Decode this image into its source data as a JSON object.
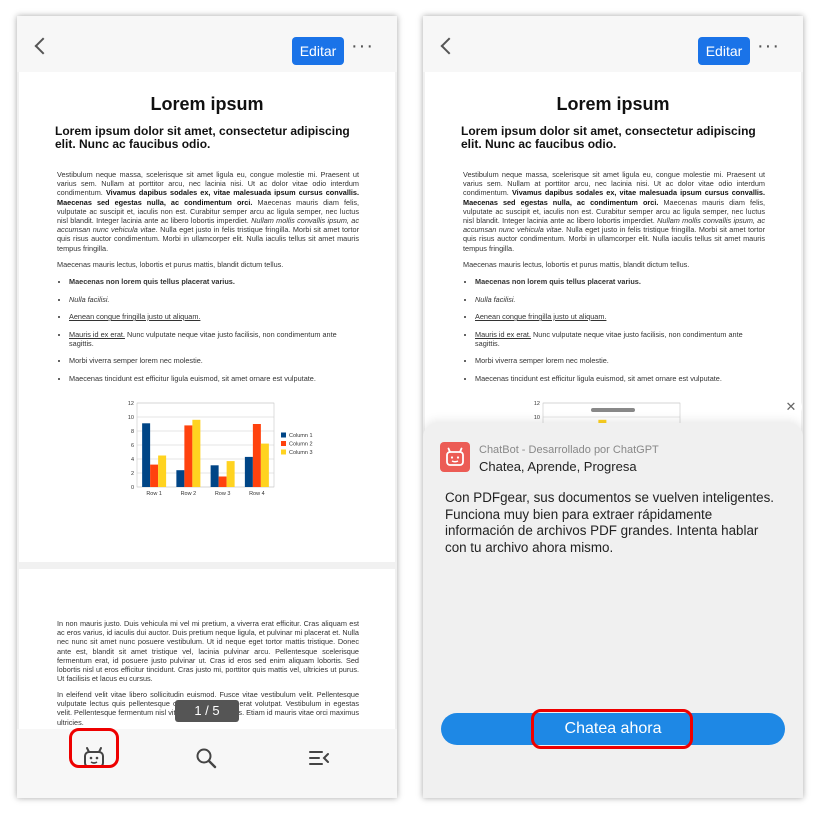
{
  "toolbar": {
    "edit_label": "Editar",
    "more_glyph": "···"
  },
  "document": {
    "title": "Lorem ipsum",
    "subtitle": "Lorem ipsum dolor sit amet, consectetur adipiscing elit. Nunc ac faucibus odio.",
    "para1_a": "Vestibulum neque massa, scelerisque sit amet ligula eu, congue molestie mi. Praesent ut varius sem. Nullam at porttitor arcu, nec lacinia nisi. Ut ac dolor vitae odio interdum condimentum. ",
    "para1_b": "Vivamus dapibus sodales ex, vitae malesuada ipsum cursus convallis. Maecenas sed egestas nulla, ac condimentum orci.",
    "para1_c": " Maecenas mauris diam felis, vulputate ac suscipit et, iaculis non est. Curabitur semper arcu ac ligula semper, nec luctus nisl blandit. Integer lacinia ante ac libero lobortis imperdiet. ",
    "para1_d": "Nullam mollis convallis ipsum, ac accumsan nunc vehicula vitae.",
    "para1_e": " Nulla eget justo in felis tristique fringilla. Morbi sit amet tortor quis risus auctor condimentum. Morbi in ullamcorper elit. Nulla iaculis tellus sit amet mauris tempus fringilla.",
    "para2": "Maecenas mauris lectus, lobortis et purus mattis, blandit dictum tellus.",
    "bullet1": "Maecenas non lorem quis tellus placerat varius.",
    "bullet2": "Nulla facilisi.",
    "bullet3": "Aenean congue fringilla justo ut aliquam.",
    "bullet4_a": "Mauris id ex erat.",
    "bullet4_b": " Nunc vulputate neque vitae justo facilisis, non condimentum ante sagittis.",
    "bullet5": "Morbi viverra semper lorem nec molestie.",
    "bullet6": "Maecenas tincidunt est efficitur ligula euismod, sit amet ornare est vulputate.",
    "page2_para1": "In non mauris justo. Duis vehicula mi vel mi pretium, a viverra erat efficitur. Cras aliquam est ac eros varius, id iaculis dui auctor. Duis pretium neque ligula, et pulvinar mi placerat et. Nulla nec nunc sit amet nunc posuere vestibulum. Ut id neque eget tortor mattis tristique. Donec ante est, blandit sit amet tristique vel, lacinia pulvinar arcu. Pellentesque scelerisque fermentum erat, id posuere justo pulvinar ut. Cras id eros sed enim aliquam lobortis. Sed lobortis nisl ut eros efficitur tincidunt. Cras justo mi, porttitor quis mattis vel, ultricies ut purus. Ut facilisis et lacus eu cursus.",
    "page2_para2": "In eleifend velit vitae libero sollicitudin euismod. Fusce vitae vestibulum velit. Pellentesque vulputate lectus quis pellentesque commodo. Aliquam erat volutpat. Vestibulum in egestas velit. Pellentesque fermentum nisl vitae fringilla venenatis. Etiam id mauris vitae orci maximus ultricies."
  },
  "pager": {
    "text": "1 / 5"
  },
  "chart_data": {
    "type": "bar",
    "categories": [
      "Row 1",
      "Row 2",
      "Row 3",
      "Row 4"
    ],
    "series": [
      {
        "name": "Column 1",
        "values": [
          9.1,
          2.4,
          3.1,
          4.3
        ],
        "color": "#004586"
      },
      {
        "name": "Column 2",
        "values": [
          3.2,
          8.8,
          1.5,
          9.0
        ],
        "color": "#ff420e"
      },
      {
        "name": "Column 3",
        "values": [
          4.5,
          9.6,
          3.7,
          6.2
        ],
        "color": "#ffd320"
      }
    ],
    "ylim": [
      0,
      12
    ],
    "yticks": [
      "0",
      "2",
      "4",
      "6",
      "8",
      "10",
      "12"
    ],
    "legend": "right",
    "grid": true
  },
  "chatbot": {
    "name": "ChatBot - Desarrollado por ChatGPT",
    "tagline": "Chatea, Aprende, Progresa",
    "message": "Con PDFgear, sus documentos se vuelven inteligentes.  Funciona muy bien para extraer rápidamente información de archivos PDF grandes. Intenta hablar con tu archivo ahora mismo.",
    "button_label": "Chatea ahora",
    "close_glyph": "✕"
  },
  "colors": {
    "accent": "#1a73e8",
    "highlight": "#e00000",
    "bot": "#ec5c55"
  },
  "icons": [
    "back-icon",
    "more-icon",
    "chatbot-icon",
    "search-icon",
    "outline-icon",
    "close-icon"
  ]
}
